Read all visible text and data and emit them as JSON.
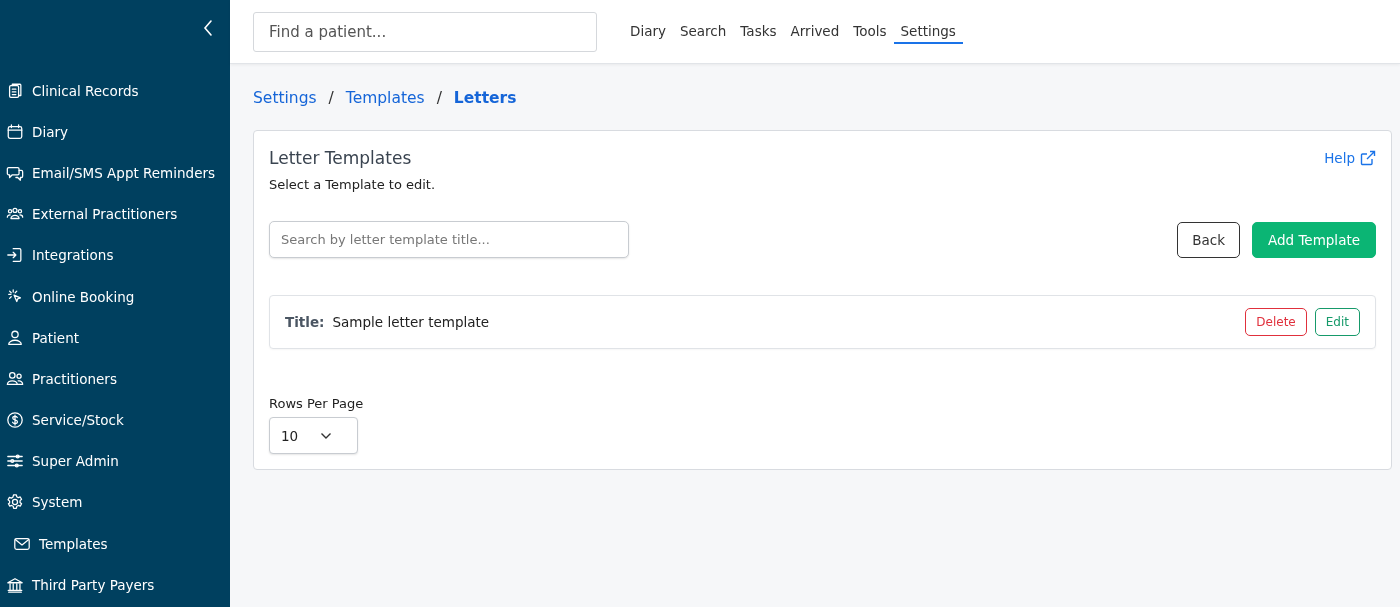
{
  "sidebar": {
    "items": [
      {
        "label": "Clinical Records",
        "selected": false
      },
      {
        "label": "Diary",
        "selected": false
      },
      {
        "label": "Email/SMS Appt Reminders",
        "selected": false
      },
      {
        "label": "External Practitioners",
        "selected": false
      },
      {
        "label": "Integrations",
        "selected": false
      },
      {
        "label": "Online Booking",
        "selected": false
      },
      {
        "label": "Patient",
        "selected": false
      },
      {
        "label": "Practitioners",
        "selected": false
      },
      {
        "label": "Service/Stock",
        "selected": false
      },
      {
        "label": "Super Admin",
        "selected": false
      },
      {
        "label": "System",
        "selected": false,
        "children": [
          {
            "label": "Templates",
            "selected": false
          }
        ]
      },
      {
        "label": "Third Party Payers",
        "selected": false
      }
    ]
  },
  "topbar": {
    "search": {
      "placeholder": "Find a patient..."
    },
    "nav": [
      {
        "label": "Diary",
        "selected": false
      },
      {
        "label": "Search",
        "selected": false
      },
      {
        "label": "Tasks",
        "selected": false
      },
      {
        "label": "Arrived",
        "selected": false
      },
      {
        "label": "Tools",
        "selected": false
      },
      {
        "label": "Settings",
        "selected": true
      }
    ]
  },
  "breadcrumb": [
    {
      "label": "Settings",
      "current": false
    },
    {
      "label": "Templates",
      "current": false
    },
    {
      "label": "Letters",
      "current": true
    }
  ],
  "breadcrumb_separator": "/",
  "panel": {
    "title": "Letter Templates",
    "help": "Help",
    "subtitle": "Select a Template to edit.",
    "search": {
      "placeholder": "Search by letter template title..."
    },
    "buttons": [
      {
        "label": "Back",
        "kind": "outline"
      },
      {
        "label": "Add Template",
        "kind": "primary"
      }
    ],
    "rows": [
      {
        "title_label": "Title:",
        "title": "Sample letter template",
        "actions": [
          {
            "label": "Delete",
            "kind": "danger"
          },
          {
            "label": "Edit",
            "kind": "success"
          }
        ]
      }
    ],
    "rows_per_page": {
      "label": "Rows Per Page",
      "value": "10"
    }
  }
}
